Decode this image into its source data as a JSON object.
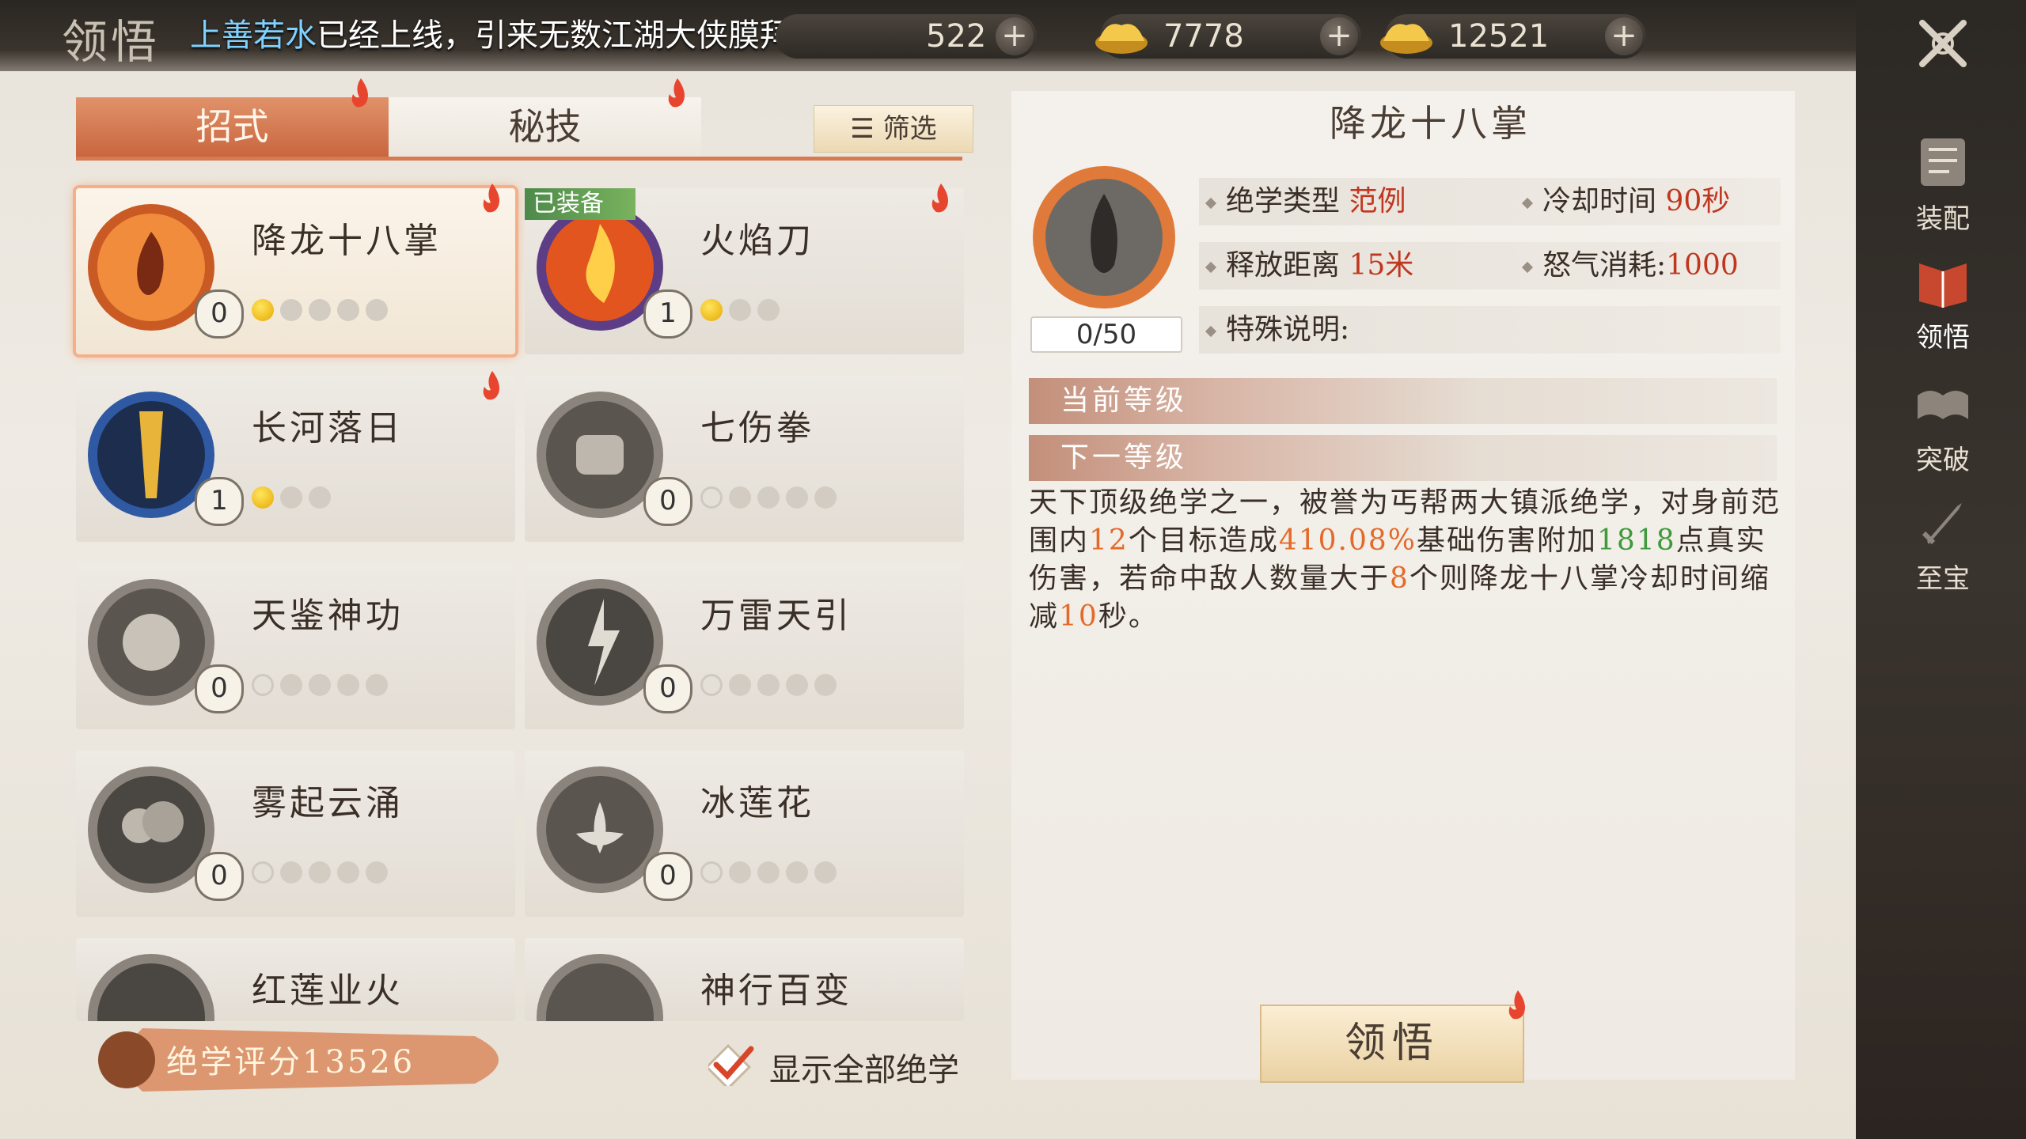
{
  "header": {
    "title": "领悟",
    "marquee_name": "上善若水",
    "marquee_text": "已经上线，引来无数江湖大侠膜拜!",
    "resources": [
      {
        "value": "522"
      },
      {
        "value": "7778"
      },
      {
        "value": "12521"
      }
    ]
  },
  "tabs": {
    "moves": "招式",
    "secret": "秘技",
    "filter": "筛选"
  },
  "skills": [
    {
      "name": "降龙十八掌",
      "level": "0",
      "equipped": false,
      "selected": true
    },
    {
      "name": "火焰刀",
      "level": "1",
      "equipped": true,
      "equip_badge": "已装备",
      "selected": false
    },
    {
      "name": "长河落日",
      "level": "1",
      "equipped": false,
      "selected": false
    },
    {
      "name": "七伤拳",
      "level": "0",
      "equipped": false,
      "selected": false
    },
    {
      "name": "天鉴神功",
      "level": "0",
      "equipped": false,
      "selected": false
    },
    {
      "name": "万雷天引",
      "level": "0",
      "equipped": false,
      "selected": false
    },
    {
      "name": "雾起云涌",
      "level": "0",
      "equipped": false,
      "selected": false
    },
    {
      "name": "冰莲花",
      "level": "0",
      "equipped": false,
      "selected": false
    },
    {
      "name": "红莲业火",
      "equipped": false,
      "selected": false
    },
    {
      "name": "神行百变",
      "equipped": false,
      "selected": false
    }
  ],
  "footer": {
    "score_label": "绝学评分13526",
    "show_all": "显示全部绝学"
  },
  "detail": {
    "title": "降龙十八掌",
    "progress": "0/50",
    "type_label": "绝学类型",
    "type_value": "范例",
    "cooldown_label": "冷却时间",
    "cooldown_value": "90秒",
    "range_label": "释放距离",
    "range_value": "15米",
    "rage_label": "怒气消耗:",
    "rage_value": "1000",
    "special_label": "特殊说明:",
    "current_level": "当前等级",
    "next_level": "下一等级",
    "desc": {
      "p1": "天下顶级绝学之一，被誉为丐帮两大镇派绝学，对身前范围内",
      "n1": "12",
      "p2": "个目标造成",
      "n2": "410.08%",
      "p3": "基础伤害附加",
      "n3": "1818",
      "p4": "点真实伤害，若命中敌人数量大于",
      "n4": "8",
      "p5": "个则降龙十八掌冷却时间缩减",
      "n5": "10",
      "p6": "秒。"
    },
    "comprehend_button": "领悟"
  },
  "sidebar": {
    "items": [
      "装配",
      "领悟",
      "突破",
      "至宝"
    ]
  },
  "colors": {
    "accent": "#c9663f",
    "value_red": "#c1361f",
    "desc_orange": "#e46a2a",
    "desc_green": "#3f9a3d"
  }
}
